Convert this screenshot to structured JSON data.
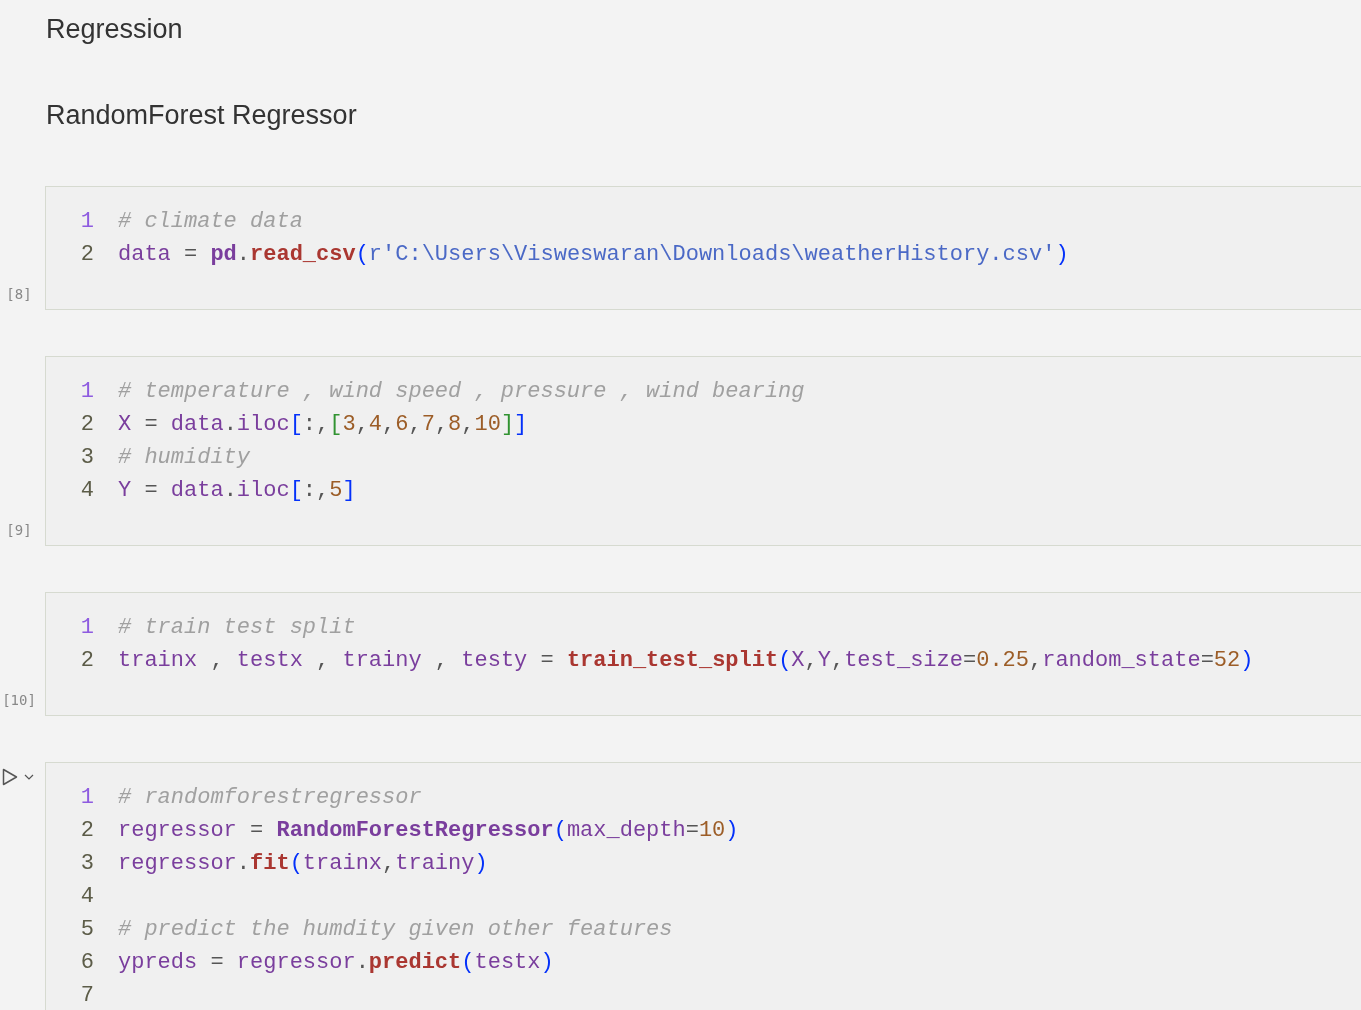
{
  "headings": [
    "Regression",
    "RandomForest Regressor"
  ],
  "cells": [
    {
      "execution_count": "[8]",
      "run_controls": false,
      "lines": [
        {
          "number": "1",
          "current": true,
          "tokens": [
            {
              "kind": "comment",
              "text": "# climate data"
            }
          ]
        },
        {
          "number": "2",
          "current": false,
          "tokens": [
            {
              "kind": "var",
              "text": "data"
            },
            {
              "kind": "op",
              "text": " = "
            },
            {
              "kind": "module",
              "text": "pd"
            },
            {
              "kind": "op",
              "text": "."
            },
            {
              "kind": "func",
              "text": "read_csv"
            },
            {
              "kind": "bracket",
              "text": "("
            },
            {
              "kind": "str",
              "text": "r'C:\\Users\\Visweswaran\\Downloads\\weatherHistory.csv'"
            },
            {
              "kind": "bracket",
              "text": ")"
            }
          ]
        }
      ]
    },
    {
      "execution_count": "[9]",
      "run_controls": false,
      "lines": [
        {
          "number": "1",
          "current": true,
          "tokens": [
            {
              "kind": "comment",
              "text": "# temperature , wind speed , pressure , wind bearing"
            }
          ]
        },
        {
          "number": "2",
          "current": false,
          "tokens": [
            {
              "kind": "var",
              "text": "X"
            },
            {
              "kind": "op",
              "text": " = "
            },
            {
              "kind": "var",
              "text": "data"
            },
            {
              "kind": "op",
              "text": "."
            },
            {
              "kind": "var",
              "text": "iloc"
            },
            {
              "kind": "bracket",
              "text": "["
            },
            {
              "kind": "op",
              "text": ":,"
            },
            {
              "kind": "bracket2",
              "text": "["
            },
            {
              "kind": "num",
              "text": "3"
            },
            {
              "kind": "op",
              "text": ","
            },
            {
              "kind": "num",
              "text": "4"
            },
            {
              "kind": "op",
              "text": ","
            },
            {
              "kind": "num",
              "text": "6"
            },
            {
              "kind": "op",
              "text": ","
            },
            {
              "kind": "num",
              "text": "7"
            },
            {
              "kind": "op",
              "text": ","
            },
            {
              "kind": "num",
              "text": "8"
            },
            {
              "kind": "op",
              "text": ","
            },
            {
              "kind": "num",
              "text": "10"
            },
            {
              "kind": "bracket2",
              "text": "]"
            },
            {
              "kind": "bracket",
              "text": "]"
            }
          ]
        },
        {
          "number": "3",
          "current": false,
          "tokens": [
            {
              "kind": "comment",
              "text": "# humidity"
            }
          ]
        },
        {
          "number": "4",
          "current": false,
          "tokens": [
            {
              "kind": "var",
              "text": "Y"
            },
            {
              "kind": "op",
              "text": " = "
            },
            {
              "kind": "var",
              "text": "data"
            },
            {
              "kind": "op",
              "text": "."
            },
            {
              "kind": "var",
              "text": "iloc"
            },
            {
              "kind": "bracket",
              "text": "["
            },
            {
              "kind": "op",
              "text": ":,"
            },
            {
              "kind": "num",
              "text": "5"
            },
            {
              "kind": "bracket",
              "text": "]"
            }
          ]
        }
      ]
    },
    {
      "execution_count": "[10]",
      "run_controls": false,
      "lines": [
        {
          "number": "1",
          "current": true,
          "tokens": [
            {
              "kind": "comment",
              "text": "# train test split"
            }
          ]
        },
        {
          "number": "2",
          "current": false,
          "tokens": [
            {
              "kind": "var",
              "text": "trainx"
            },
            {
              "kind": "op",
              "text": " , "
            },
            {
              "kind": "var",
              "text": "testx"
            },
            {
              "kind": "op",
              "text": " , "
            },
            {
              "kind": "var",
              "text": "trainy"
            },
            {
              "kind": "op",
              "text": " , "
            },
            {
              "kind": "var",
              "text": "testy"
            },
            {
              "kind": "op",
              "text": " = "
            },
            {
              "kind": "func",
              "text": "train_test_split"
            },
            {
              "kind": "bracket",
              "text": "("
            },
            {
              "kind": "var",
              "text": "X"
            },
            {
              "kind": "op",
              "text": ","
            },
            {
              "kind": "var",
              "text": "Y"
            },
            {
              "kind": "op",
              "text": ","
            },
            {
              "kind": "var",
              "text": "test_size"
            },
            {
              "kind": "op",
              "text": "="
            },
            {
              "kind": "num",
              "text": "0.25"
            },
            {
              "kind": "op",
              "text": ","
            },
            {
              "kind": "var",
              "text": "random_state"
            },
            {
              "kind": "op",
              "text": "="
            },
            {
              "kind": "num",
              "text": "52"
            },
            {
              "kind": "bracket",
              "text": ")"
            }
          ]
        }
      ]
    },
    {
      "run_controls": true,
      "lines": [
        {
          "number": "1",
          "current": true,
          "tokens": [
            {
              "kind": "comment",
              "text": "# randomforestregressor"
            }
          ]
        },
        {
          "number": "2",
          "current": false,
          "tokens": [
            {
              "kind": "var",
              "text": "regressor"
            },
            {
              "kind": "op",
              "text": " = "
            },
            {
              "kind": "class",
              "text": "RandomForestRegressor"
            },
            {
              "kind": "bracket",
              "text": "("
            },
            {
              "kind": "var",
              "text": "max_depth"
            },
            {
              "kind": "op",
              "text": "="
            },
            {
              "kind": "num",
              "text": "10"
            },
            {
              "kind": "bracket",
              "text": ")"
            }
          ]
        },
        {
          "number": "3",
          "current": false,
          "tokens": [
            {
              "kind": "var",
              "text": "regressor"
            },
            {
              "kind": "op",
              "text": "."
            },
            {
              "kind": "func",
              "text": "fit"
            },
            {
              "kind": "bracket",
              "text": "("
            },
            {
              "kind": "var",
              "text": "trainx"
            },
            {
              "kind": "op",
              "text": ","
            },
            {
              "kind": "var",
              "text": "trainy"
            },
            {
              "kind": "bracket",
              "text": ")"
            }
          ]
        },
        {
          "number": "4",
          "current": false
        },
        {
          "number": "5",
          "current": false,
          "tokens": [
            {
              "kind": "comment",
              "text": "# predict the humdity given other features"
            }
          ]
        },
        {
          "number": "6",
          "current": false,
          "tokens": [
            {
              "kind": "var",
              "text": "ypreds"
            },
            {
              "kind": "op",
              "text": " = "
            },
            {
              "kind": "var",
              "text": "regressor"
            },
            {
              "kind": "op",
              "text": "."
            },
            {
              "kind": "func",
              "text": "predict"
            },
            {
              "kind": "bracket",
              "text": "("
            },
            {
              "kind": "var",
              "text": "testx"
            },
            {
              "kind": "bracket",
              "text": ")"
            }
          ]
        },
        {
          "number": "7",
          "current": false
        }
      ]
    }
  ]
}
